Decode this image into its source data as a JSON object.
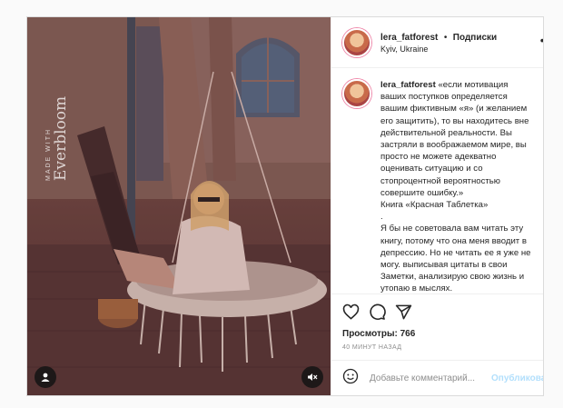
{
  "post": {
    "username": "lera_fatforest",
    "separator": "•",
    "follow_label": "Подписки",
    "location": "Kyiv, Ukraine",
    "more_icon": "more-horizontal-icon"
  },
  "photo": {
    "watermark_made": "MADE WITH",
    "watermark_brand": "Everbloom",
    "user_tag_icon": "user-tag-icon",
    "mute_icon": "speaker-muted-icon"
  },
  "caption": {
    "username": "lera_fatforest",
    "text": "«если мотивация\nваших поступков определяется\nвашим фиктивным «я» (и желанием\nего защитить), то вы находитесь вне\nдействительной реальности. Вы\nзастряли в воображаемом мире, вы\nпросто не можете адекватно\nоценивать ситуацию и со\nстопроцентной вероятностью\nсовершите ошибку.»\nКнига «Красная Таблетка»\n.\nЯ бы не советовала вам читать эту\nкнигу, потому что она меня вводит в\nдепрессию. Но не читать ее я уже не\nмогу. выписывая цитаты в свои\nЗаметки, анализирую свою жизнь и\nутопаю в мыслях.\nТак что если в садомазо 😭, то"
  },
  "actions": {
    "icons": [
      "heart-icon",
      "comment-icon",
      "share-icon",
      "bookmark-icon"
    ],
    "views_label": "Просмотры:",
    "views_count": "766",
    "time_ago": "40 минут назад"
  },
  "comment": {
    "emoji_icon": "emoji-icon",
    "placeholder": "Добавьте комментарий...",
    "post_label": "Опубликовать"
  },
  "colors": {
    "text": "#262626",
    "secondary": "#8e8e8e",
    "post_button_disabled": "#b2dffc",
    "border": "#dbdbdb"
  }
}
